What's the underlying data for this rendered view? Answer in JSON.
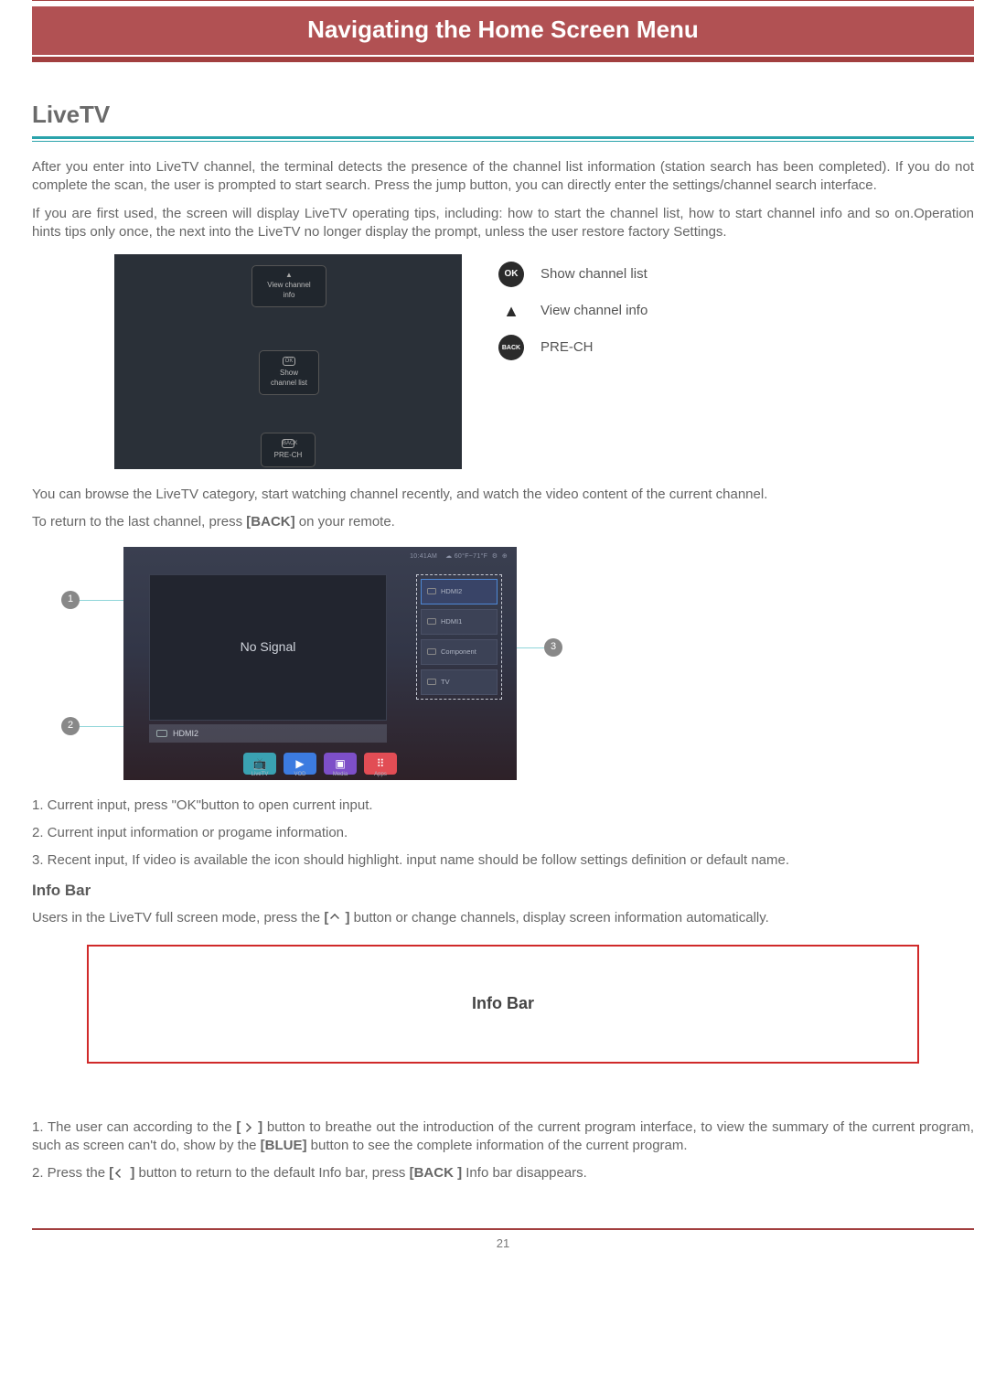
{
  "header": {
    "title": "Navigating the Home Screen Menu"
  },
  "section": {
    "title": "LiveTV"
  },
  "para1": "After you enter into LiveTV channel, the terminal detects the presence of the channel list information (station search has been completed). If you do not complete the scan, the user is prompted to start search. Press the jump button, you can directly enter the settings/channel search interface.",
  "para2": "If you are first used, the screen will display LiveTV operating tips, including: how to start the channel list, how to start channel info and so on.Operation hints tips only once, the next into the LiveTV no longer display the prompt, unless the user restore factory Settings.",
  "fig1": {
    "bubble_top": "View channel info",
    "bubble_mid_icon": "OK",
    "bubble_mid": "Show channel list",
    "bubble_bot_icon": "BACK",
    "bubble_bot": "PRE-CH"
  },
  "legend": {
    "ok_icon": "OK",
    "ok_text": "Show channel list",
    "tri_icon": "▲",
    "tri_text": "View channel info",
    "back_icon": "BACK",
    "back_text": "PRE-CH"
  },
  "para3": "You can browse the LiveTV category, start watching channel recently, and watch the video content of the current channel.",
  "para4a": "To return to the last channel, press ",
  "para4b": "[BACK]",
  "para4c": " on your remote.",
  "fig2": {
    "status_time": "10:41AM",
    "status_weather": "60°F~71°F",
    "preview_text": "No Signal",
    "current_input": "HDMI2",
    "inputs": [
      "HDMI2",
      "HDMI1",
      "Component",
      "TV"
    ],
    "apps": [
      "LiveTV",
      "VOD",
      "Media",
      "Apps"
    ]
  },
  "callouts": {
    "n1": "1",
    "n2": "2",
    "n3": "3"
  },
  "list1": "1. Current input, press \"OK\"button to open current input.",
  "list2": "2. Current input information or progame information.",
  "list3": "3. Recent input, If video is available the icon should highlight. input name should be follow settings definition or default name.",
  "subhead": "Info Bar",
  "para5a": "Users in the LiveTV full screen mode, press the ",
  "para5b": "[",
  "para5c": " ]",
  "para5d": " button or change channels, display screen information automatically.",
  "infobar_label": "Info Bar",
  "para6a": "1. The user can according to the ",
  "para6b": "[",
  "para6c": " ]",
  "para6d": " button to breathe out the introduction of the current program interface, to view the summary of the current program, such as screen can't do, show by the ",
  "para6e": "[BLUE]",
  "para6f": " button to see the complete information of the current program.",
  "para7a": "2. Press the ",
  "para7b": "[",
  "para7c": " ]",
  "para7d": " button to return to the default Info bar, press ",
  "para7e": "[BACK ]",
  "para7f": " Info bar disappears.",
  "page_number": "21"
}
